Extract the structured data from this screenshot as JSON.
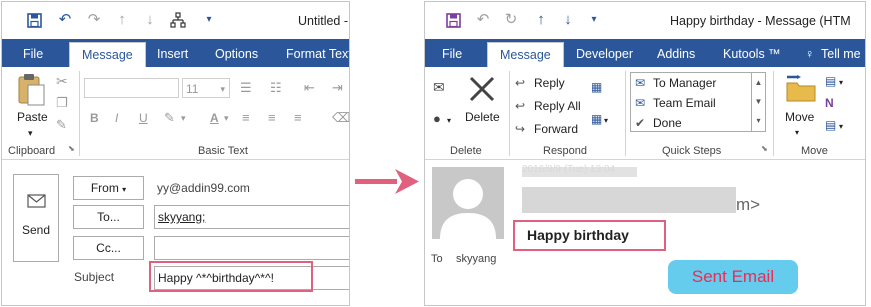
{
  "left_window": {
    "title": "Untitled -",
    "qat_icons": [
      "save-icon",
      "undo-icon",
      "redo-icon",
      "up-arrow-icon",
      "down-arrow-icon",
      "organization-icon",
      "customize-dropdown-icon"
    ],
    "tabs": [
      "File",
      "Message",
      "Insert",
      "Options",
      "Format Text"
    ],
    "active_tab": "Message",
    "clipboard": {
      "paste": "Paste",
      "group": "Clipboard"
    },
    "basic_text": {
      "font_size": "11",
      "group": "Basic Text",
      "buttons": [
        "B",
        "I",
        "U"
      ]
    },
    "compose": {
      "send": "Send",
      "from_button": "From",
      "from_value": "yy@addin99.com",
      "to_button": "To...",
      "to_value": "skyyang;",
      "cc_button": "Cc...",
      "cc_value": "",
      "subject_label": "Subject",
      "subject_value": "Happy ^*^birthday^*^!"
    }
  },
  "right_window": {
    "title": "Happy birthday  - Message (HTM",
    "tabs": [
      "File",
      "Message",
      "Developer",
      "Addins",
      "Kutools ™",
      "Tell me"
    ],
    "active_tab": "Message",
    "delete_group": {
      "delete": "Delete",
      "group": "Delete"
    },
    "respond_group": {
      "reply": "Reply",
      "reply_all": "Reply All",
      "forward": "Forward",
      "group": "Respond"
    },
    "quick_steps": {
      "items": [
        "To Manager",
        "Team Email",
        "Done"
      ],
      "group": "Quick Steps"
    },
    "move_group": {
      "move": "Move",
      "group": "Move"
    },
    "message": {
      "date_partial": "2016/8/9 (Tue) 13:04",
      "sender_partial": "m>",
      "subject": "Happy birthday",
      "to_label": "To",
      "to_value": "skyyang"
    }
  },
  "annotation": {
    "sent_label": "Sent Email"
  },
  "colors": {
    "ribbon_blue": "#2b579a",
    "highlight": "#e0607e",
    "arrow": "#e0607e",
    "badge_bg": "#66ccee",
    "badge_text": "#ee2a55"
  }
}
